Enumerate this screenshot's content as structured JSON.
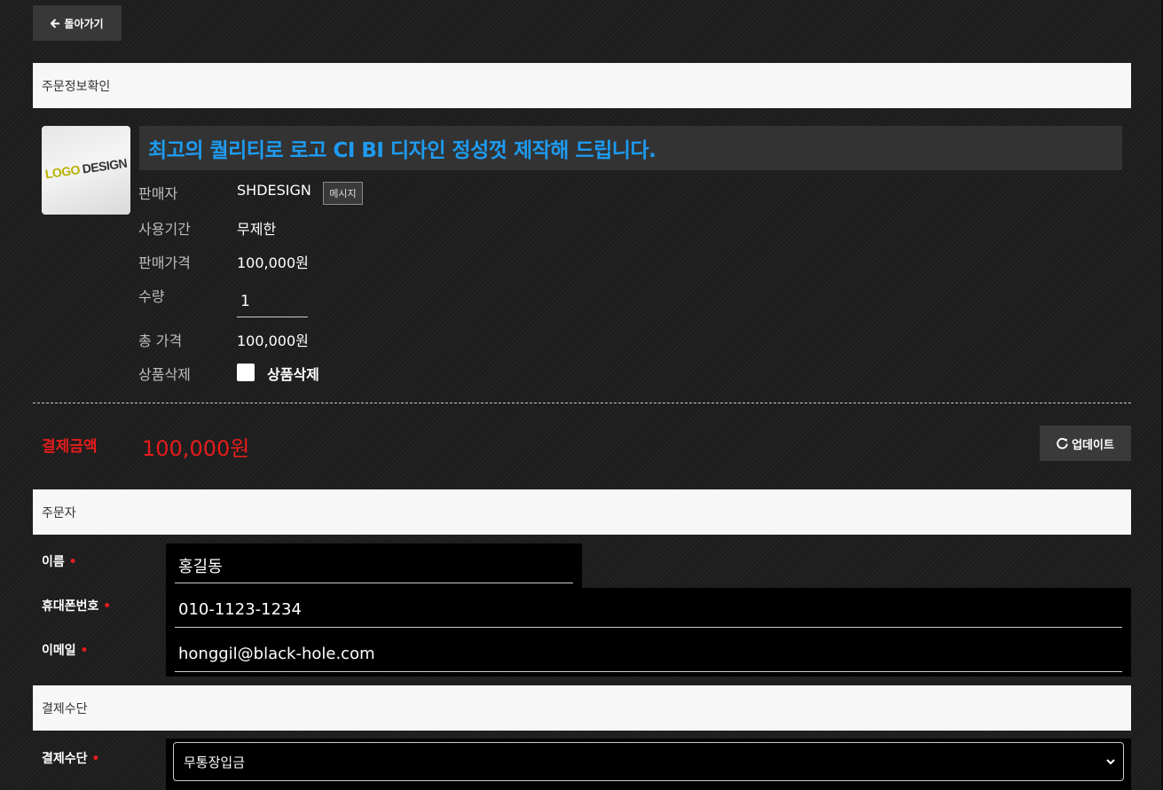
{
  "nav": {
    "back_label": "돌아가기"
  },
  "sections": {
    "order_info": "주문정보확인",
    "orderer": "주문자",
    "payment_method": "결제수단"
  },
  "product": {
    "thumb_text": {
      "w1": "LOGO",
      "w2": "DESIGN"
    },
    "title": "최고의 퀄리티로 로고 CI BI 디자인 정성껏 제작해 드립니다.",
    "seller_label": "판매자",
    "seller": "SHDESIGN",
    "message_button": "메시지",
    "period_label": "사용기간",
    "period": "무제한",
    "price_label": "판매가격",
    "price": "100,000원",
    "qty_label": "수량",
    "qty": "1",
    "total_label": "총 가격",
    "total": "100,000원",
    "delete_label": "상품삭제",
    "delete_checkbox_label": "상품삭제"
  },
  "payment": {
    "amount_label": "결제금액",
    "amount": "100,000원",
    "update_button": "업데이트"
  },
  "orderer": {
    "name_label": "이름",
    "name": "홍길동",
    "phone_label": "휴대폰번호",
    "phone": "010-1123-1234",
    "email_label": "이메일",
    "email": "honggil@black-hole.com",
    "required_mark": "•"
  },
  "payment_method": {
    "label": "결제수단",
    "selected": "무통장입금"
  },
  "colors": {
    "accent_blue": "#1e9bf0",
    "price_red": "#e51c1c"
  }
}
